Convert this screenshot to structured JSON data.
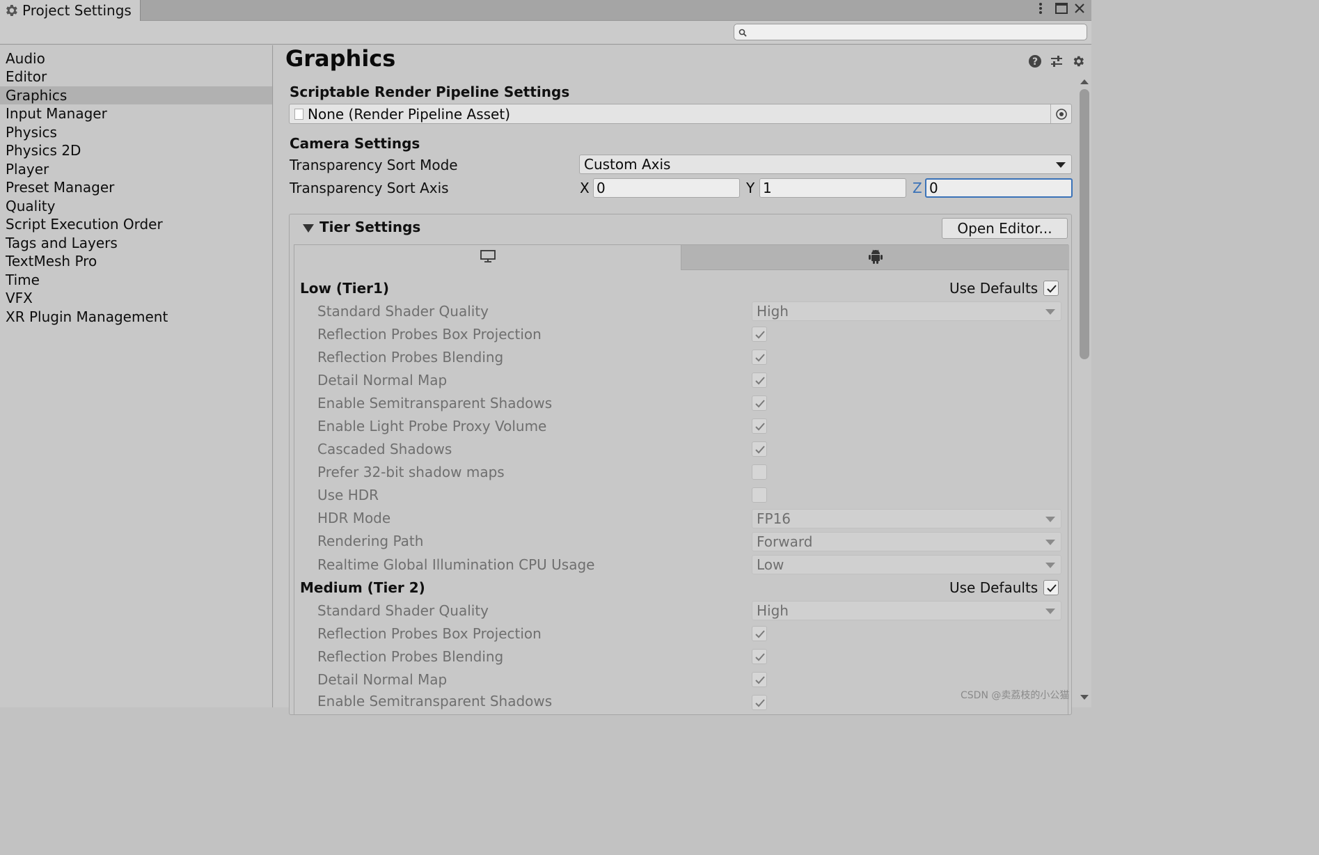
{
  "window": {
    "tab_title": "Project Settings",
    "search_placeholder": "",
    "controls": [
      "more-icon",
      "maximize-icon",
      "close-icon"
    ]
  },
  "sidebar": {
    "items": [
      {
        "label": "Audio"
      },
      {
        "label": "Editor"
      },
      {
        "label": "Graphics",
        "selected": true
      },
      {
        "label": "Input Manager"
      },
      {
        "label": "Physics"
      },
      {
        "label": "Physics 2D"
      },
      {
        "label": "Player"
      },
      {
        "label": "Preset Manager"
      },
      {
        "label": "Quality"
      },
      {
        "label": "Script Execution Order"
      },
      {
        "label": "Tags and Layers"
      },
      {
        "label": "TextMesh Pro"
      },
      {
        "label": "Time"
      },
      {
        "label": "VFX"
      },
      {
        "label": "XR Plugin Management"
      }
    ]
  },
  "main": {
    "title": "Graphics",
    "header_icons": [
      "help-icon",
      "presets-icon",
      "settings-icon"
    ],
    "srp": {
      "heading": "Scriptable Render Pipeline Settings",
      "value": "None (Render Pipeline Asset)"
    },
    "camera": {
      "heading": "Camera Settings",
      "sort_mode_label": "Transparency Sort Mode",
      "sort_mode_value": "Custom Axis",
      "sort_axis_label": "Transparency Sort Axis",
      "axis": {
        "x_label": "X",
        "x": "0",
        "y_label": "Y",
        "y": "1",
        "z_label": "Z",
        "z": "0"
      }
    },
    "tier": {
      "heading": "Tier Settings",
      "open_editor": "Open Editor...",
      "tabs": [
        "monitor-icon",
        "android-icon"
      ],
      "low": {
        "title": "Low (Tier1)",
        "use_defaults": "Use Defaults",
        "use_defaults_checked": true,
        "rows": [
          {
            "label": "Standard Shader Quality",
            "type": "dropdown",
            "value": "High"
          },
          {
            "label": "Reflection Probes Box Projection",
            "type": "checkbox",
            "checked": true
          },
          {
            "label": "Reflection Probes Blending",
            "type": "checkbox",
            "checked": true
          },
          {
            "label": "Detail Normal Map",
            "type": "checkbox",
            "checked": true
          },
          {
            "label": "Enable Semitransparent Shadows",
            "type": "checkbox",
            "checked": true
          },
          {
            "label": "Enable Light Probe Proxy Volume",
            "type": "checkbox",
            "checked": true
          },
          {
            "label": "Cascaded Shadows",
            "type": "checkbox",
            "checked": true
          },
          {
            "label": "Prefer 32-bit shadow maps",
            "type": "checkbox",
            "checked": false
          },
          {
            "label": "Use HDR",
            "type": "checkbox",
            "checked": false
          },
          {
            "label": "HDR Mode",
            "type": "dropdown",
            "value": "FP16"
          },
          {
            "label": "Rendering Path",
            "type": "dropdown",
            "value": "Forward"
          },
          {
            "label": "Realtime Global Illumination CPU Usage",
            "type": "dropdown",
            "value": "Low"
          }
        ]
      },
      "medium": {
        "title": "Medium (Tier 2)",
        "use_defaults": "Use Defaults",
        "use_defaults_checked": true,
        "rows": [
          {
            "label": "Standard Shader Quality",
            "type": "dropdown",
            "value": "High"
          },
          {
            "label": "Reflection Probes Box Projection",
            "type": "checkbox",
            "checked": true
          },
          {
            "label": "Reflection Probes Blending",
            "type": "checkbox",
            "checked": true
          },
          {
            "label": "Detail Normal Map",
            "type": "checkbox",
            "checked": true
          },
          {
            "label": "Enable Semitransparent Shadows",
            "type": "checkbox",
            "checked": true
          }
        ]
      }
    }
  },
  "watermark": "CSDN @卖荔枝的小公猫"
}
